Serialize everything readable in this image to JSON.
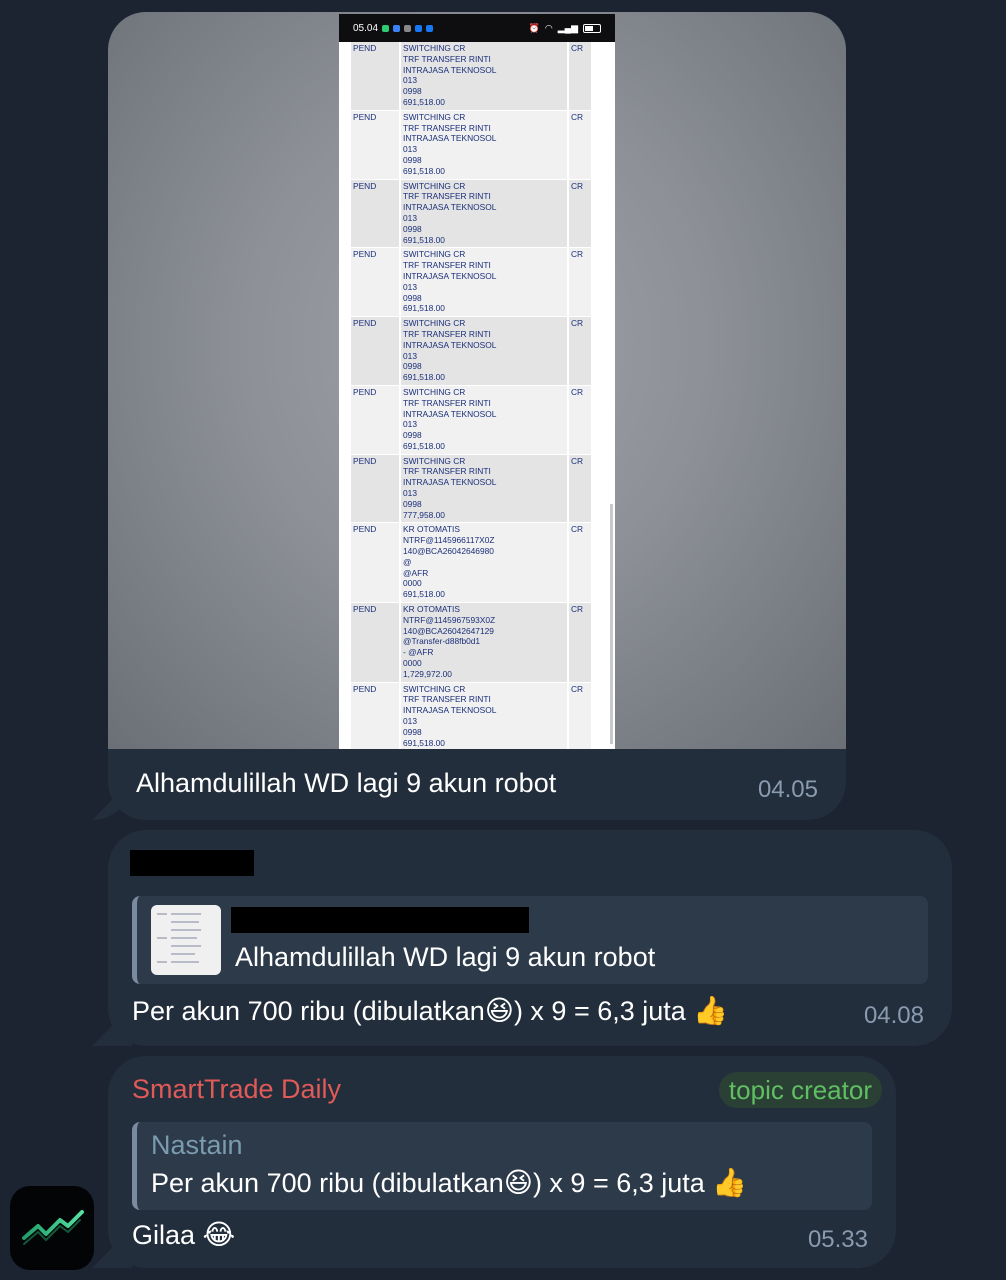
{
  "colors": {
    "background": "#1b2430",
    "bubble": "#222e3b",
    "quote_bg": "#2c3a4a",
    "sender_name": "#e05a58",
    "badge_text": "#5fbf62",
    "timestamp": "#8a9bb0"
  },
  "messages": [
    {
      "type": "photo",
      "screenshot": {
        "status_time": "05.04",
        "transactions": [
          {
            "status": "PEND",
            "lines": [
              "SWITCHING CR",
              "TRF TRANSFER RINTI",
              "INTRAJASA TEKNOSOL",
              "013",
              "0998",
              "691,518.00"
            ],
            "type": "CR"
          },
          {
            "status": "PEND",
            "lines": [
              "SWITCHING CR",
              "TRF TRANSFER RINTI",
              "INTRAJASA TEKNOSOL",
              "013",
              "0998",
              "691,518.00"
            ],
            "type": "CR"
          },
          {
            "status": "PEND",
            "lines": [
              "SWITCHING CR",
              "TRF TRANSFER RINTI",
              "INTRAJASA TEKNOSOL",
              "013",
              "0998",
              "691,518.00"
            ],
            "type": "CR"
          },
          {
            "status": "PEND",
            "lines": [
              "SWITCHING CR",
              "TRF TRANSFER RINTI",
              "INTRAJASA TEKNOSOL",
              "013",
              "0998",
              "691,518.00"
            ],
            "type": "CR"
          },
          {
            "status": "PEND",
            "lines": [
              "SWITCHING CR",
              "TRF TRANSFER RINTI",
              "INTRAJASA TEKNOSOL",
              "013",
              "0998",
              "691,518.00"
            ],
            "type": "CR"
          },
          {
            "status": "PEND",
            "lines": [
              "SWITCHING CR",
              "TRF TRANSFER RINTI",
              "INTRAJASA TEKNOSOL",
              "013",
              "0998",
              "691,518.00"
            ],
            "type": "CR"
          },
          {
            "status": "PEND",
            "lines": [
              "SWITCHING CR",
              "TRF TRANSFER RINTI",
              "INTRAJASA TEKNOSOL",
              "013",
              "0998",
              "777,958.00"
            ],
            "type": "CR"
          },
          {
            "status": "PEND",
            "lines": [
              "KR OTOMATIS",
              "NTRF@1145966117X0Z",
              "140@BCA26042646980",
              "@",
              "@AFR",
              "0000",
              "691,518.00"
            ],
            "type": "CR"
          },
          {
            "status": "PEND",
            "lines": [
              "KR OTOMATIS",
              "NTRF@1145967593X0Z",
              "140@BCA26042647129",
              "@Transfer-d88fb0d1",
              "- @AFR",
              "0000",
              "1,729,972.00"
            ],
            "type": "CR"
          },
          {
            "status": "PEND",
            "lines": [
              "SWITCHING CR",
              "TRF TRANSFER RINTI",
              "INTRAJASA TEKNOSOL",
              "013",
              "0998",
              "691,518.00"
            ],
            "type": "CR"
          }
        ]
      },
      "caption": "Alhamdulillah WD lagi 9 akun robot",
      "time": "04.05"
    },
    {
      "type": "reply",
      "quote_text": "Alhamdulillah WD lagi 9 akun robot",
      "text": "Per akun 700 ribu (dibulatkan",
      "text_after": ") x 9 = 6,3 juta",
      "emoji_1": "😆",
      "emoji_2": "👍",
      "time": "04.08"
    },
    {
      "type": "reply",
      "sender": "SmartTrade Daily",
      "badge": "topic creator",
      "quote_name": "Nastain",
      "quote_text": "Per akun 700 ribu (dibulatkan",
      "quote_text_after": ") x 9 = 6,3 juta",
      "quote_emoji_1": "😆",
      "quote_emoji_2": "👍",
      "text": "Gilaa",
      "emoji": "😂",
      "time": "05.33"
    }
  ],
  "avatar_icon": "trend-chart-icon"
}
